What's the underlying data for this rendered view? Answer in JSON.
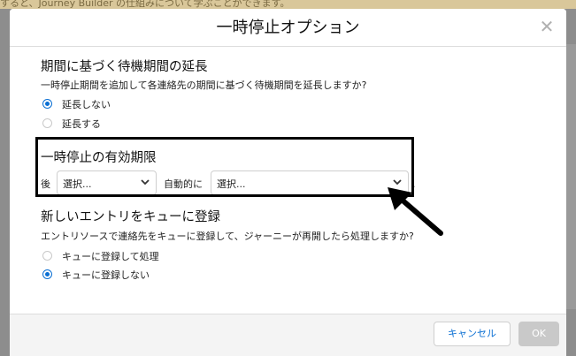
{
  "background": {
    "banner_text": "すると、Journey Builder の仕組みについて学ぶことができます。"
  },
  "modal": {
    "title": "一時停止オプション",
    "close_icon": "close-icon"
  },
  "section_extend": {
    "title": "期間に基づく待機期間の延長",
    "description": "一時停止期間を追加して各連絡先の期間に基づく待機期間を延長しますか?",
    "options": [
      {
        "label": "延長しない",
        "checked": true
      },
      {
        "label": "延長する",
        "checked": false
      }
    ]
  },
  "section_expiry": {
    "title": "一時停止の有効期限",
    "after_label": "後",
    "after_select_value": "選択...",
    "auto_label": "自動的に",
    "auto_select_value": "選択...",
    "trailing": "."
  },
  "section_queue": {
    "title": "新しいエントリをキューに登録",
    "description": "エントリソースで連絡先をキューに登録して、ジャーニーが再開したら処理しますか?",
    "options": [
      {
        "label": "キューに登録して処理",
        "checked": false
      },
      {
        "label": "キューに登録しない",
        "checked": true
      }
    ]
  },
  "footer": {
    "cancel_label": "キャンセル",
    "ok_label": "OK"
  },
  "colors": {
    "accent": "#0a6fd3",
    "annotation": "#000000"
  }
}
